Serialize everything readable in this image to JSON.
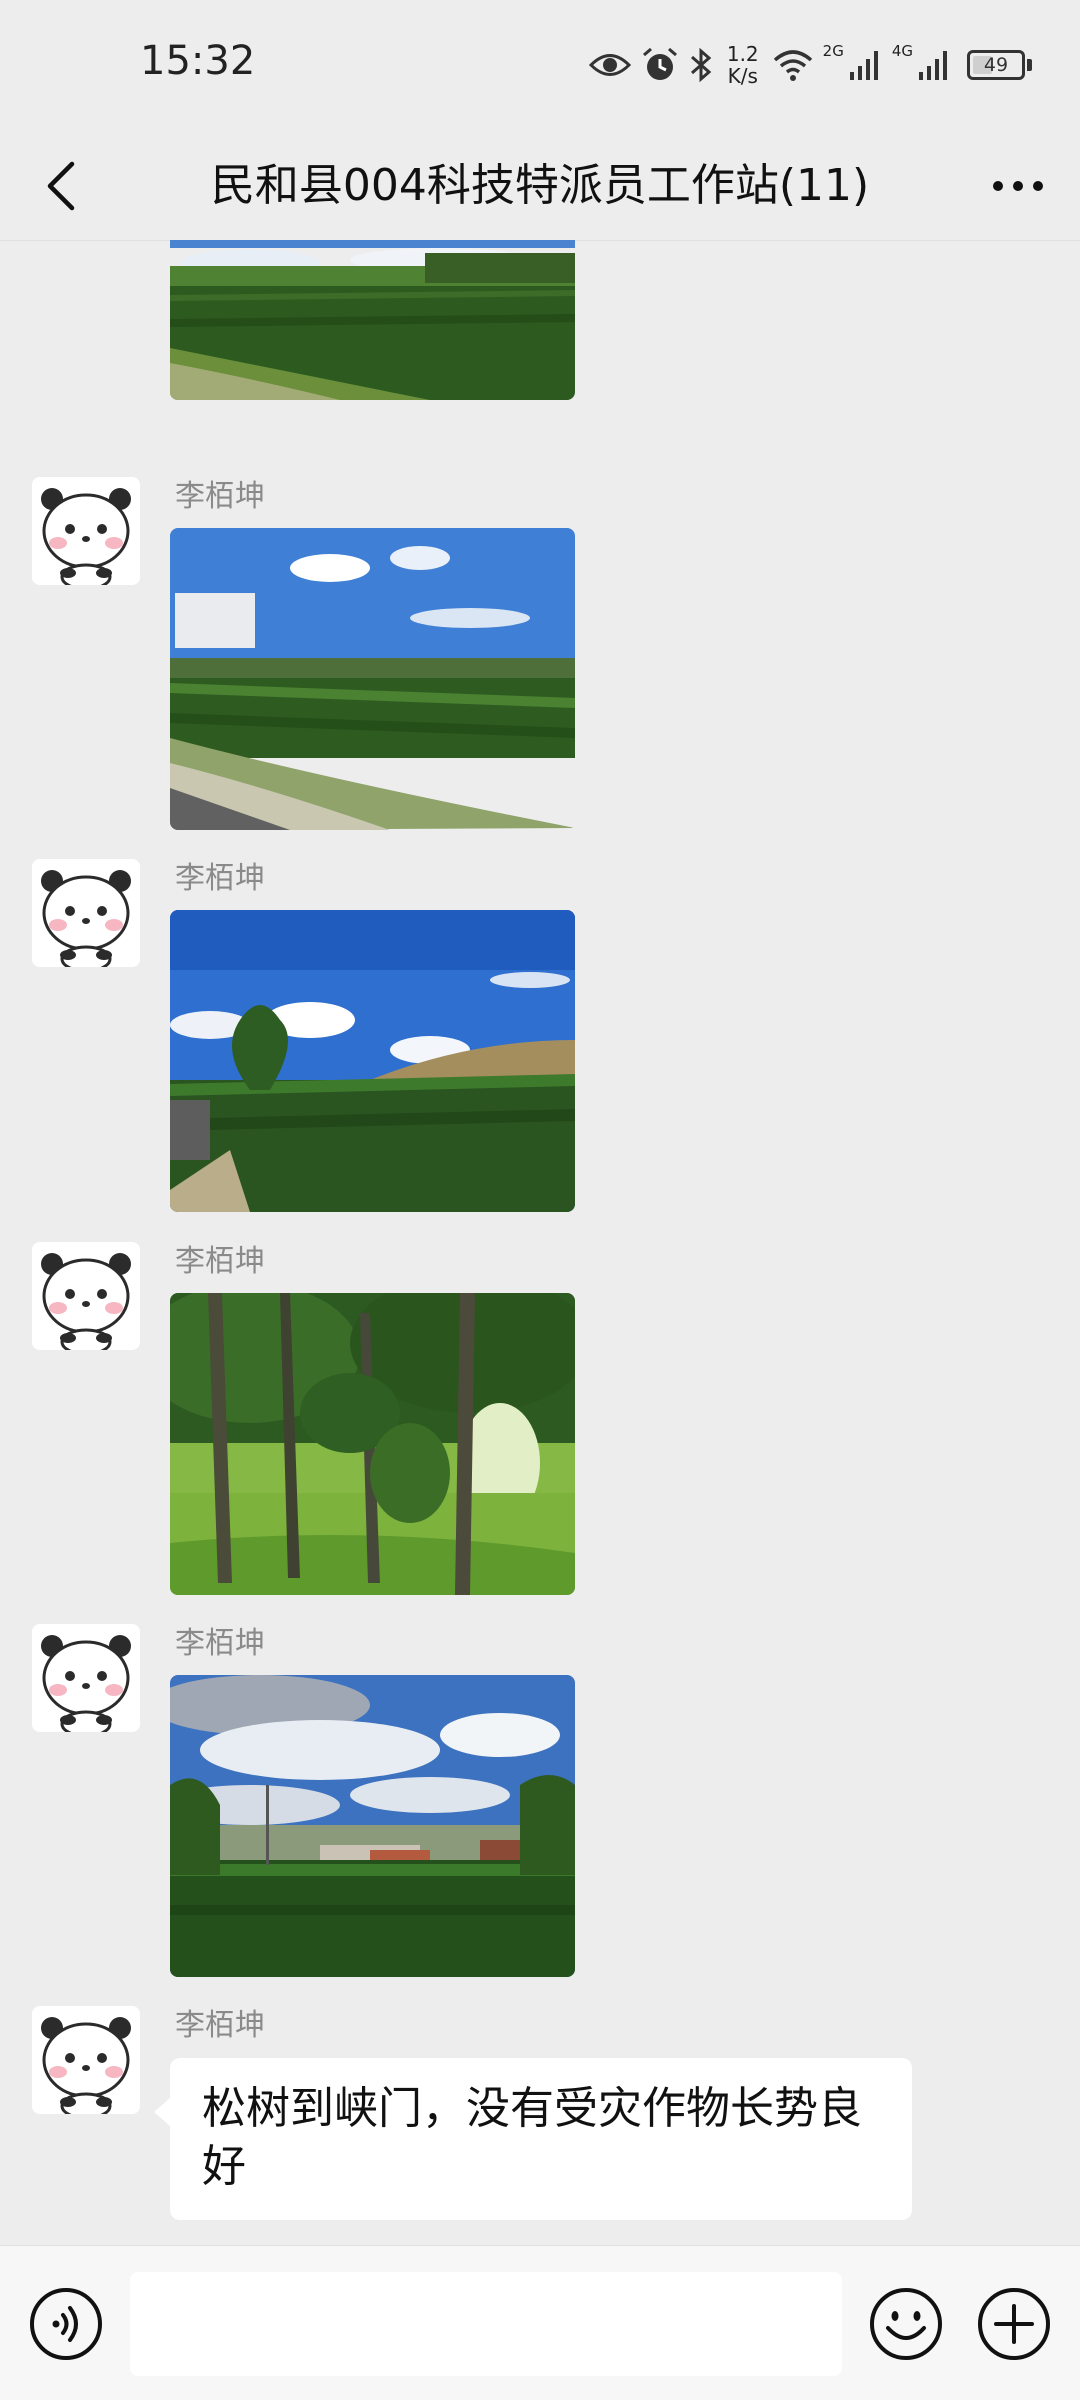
{
  "status_bar": {
    "time": "15:32",
    "speed_value": "1.2",
    "speed_unit": "K/s",
    "network_1": "2G",
    "network_2": "4G",
    "battery_percent": "49",
    "battery_level": 0.49,
    "icons": [
      "eye-icon",
      "alarm-icon",
      "bluetooth-icon",
      "wifi-icon",
      "signal-icon",
      "signal-icon",
      "battery-icon"
    ]
  },
  "header": {
    "back_icon": "chevron-left-icon",
    "title": "民和县004科技特派员工作站(11)",
    "more_icon": "more-horizontal-icon"
  },
  "messages": [
    {
      "type": "image",
      "sender": "",
      "content": "cornfield-photo"
    },
    {
      "type": "image",
      "sender": "李栢坤",
      "content": "cornfield-photo"
    },
    {
      "type": "image",
      "sender": "李栢坤",
      "content": "cornfield-photo"
    },
    {
      "type": "image",
      "sender": "李栢坤",
      "content": "trees-photo"
    },
    {
      "type": "image",
      "sender": "李栢坤",
      "content": "cornfield-photo"
    },
    {
      "type": "text",
      "sender": "李栢坤",
      "text": "松树到峡门，没有受灾作物长势良好"
    }
  ],
  "input_bar": {
    "voice_icon": "voice-icon",
    "input_value": "",
    "emoji_icon": "emoji-icon",
    "plus_icon": "plus-icon"
  },
  "colors": {
    "background": "#ededed",
    "bubble": "#ffffff",
    "sender_name": "#8a8a8a",
    "input_bar": "#f7f7f7"
  }
}
